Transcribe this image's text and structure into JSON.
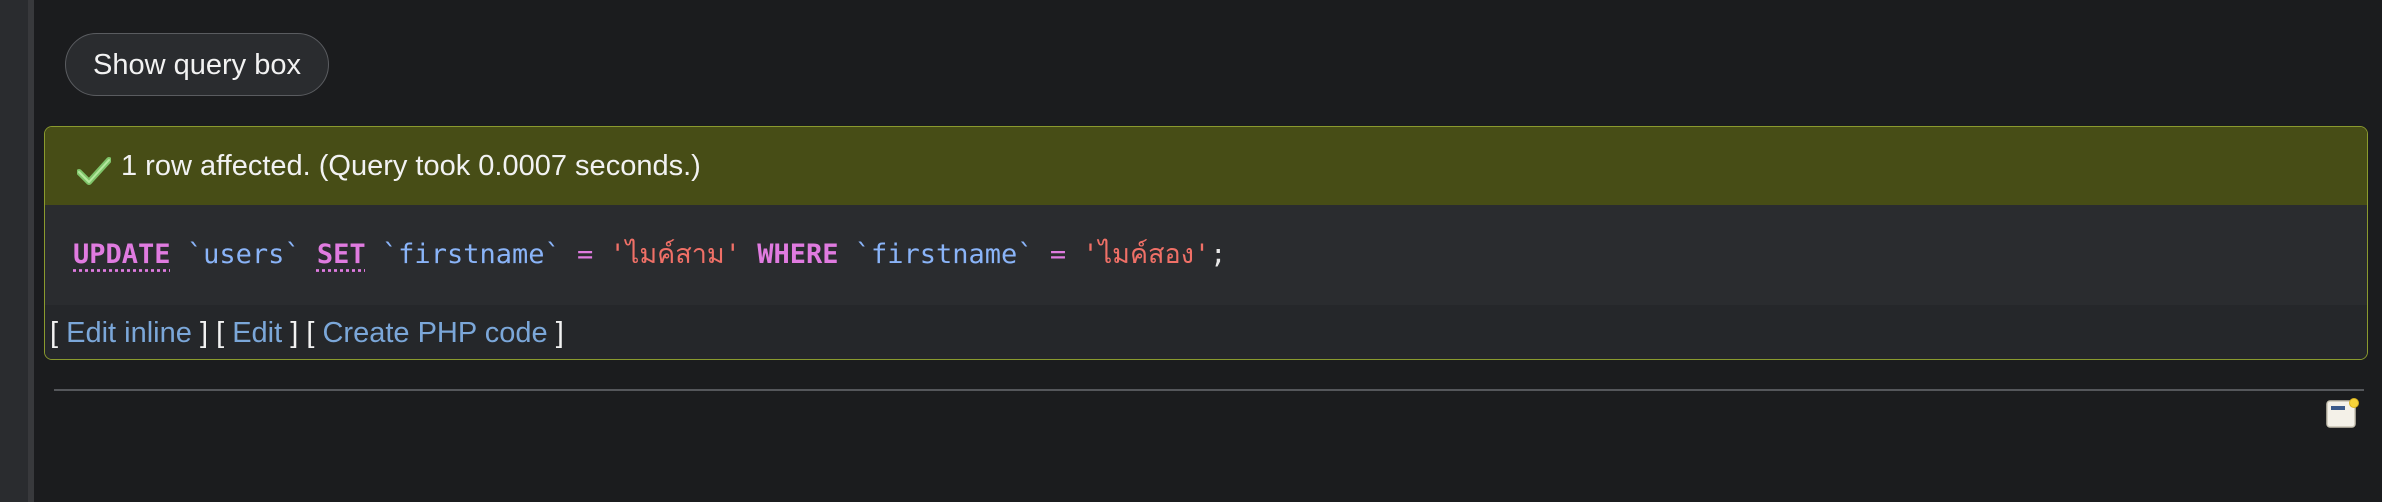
{
  "query_box": {
    "toggle_label": "Show query box"
  },
  "result": {
    "message": "1 row affected. (Query took 0.0007 seconds.)",
    "status_color": "#474d16",
    "icon": "checkmark-icon"
  },
  "sql": {
    "kw_update": "UPDATE",
    "t_table": "`users`",
    "kw_set": "SET",
    "t_col1": "`firstname`",
    "op1": "=",
    "str1": "'ไมค์สาม'",
    "kw_where": "WHERE",
    "t_col2": "`firstname`",
    "op2": "=",
    "str2": "'ไมค์สอง'",
    "end": ";"
  },
  "actions": {
    "bracket_open": "[",
    "bracket_close": "]",
    "edit_inline": "Edit inline",
    "edit": "Edit",
    "create_php": "Create PHP code"
  },
  "console": {
    "icon": "console-window-icon"
  }
}
